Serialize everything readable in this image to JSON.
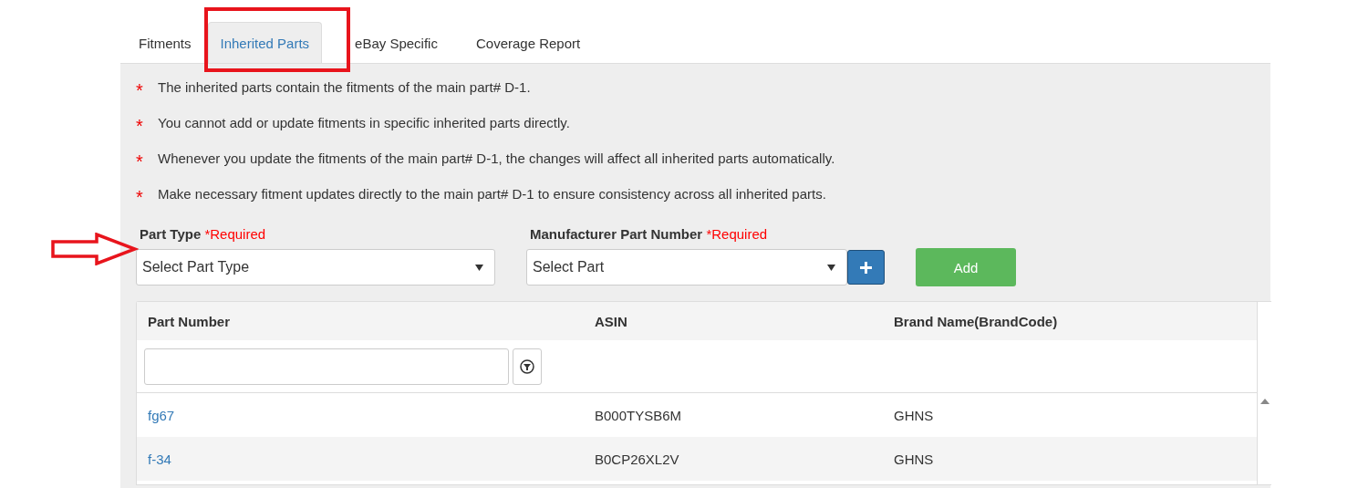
{
  "tabs": [
    {
      "label": "Fitments",
      "selected": false
    },
    {
      "label": "Inherited Parts",
      "selected": true
    },
    {
      "label": "eBay Specific",
      "selected": false
    },
    {
      "label": "Coverage Report",
      "selected": false
    }
  ],
  "notes": [
    {
      "marker": "*",
      "text": "The inherited parts contain the fitments of the main part# D-1."
    },
    {
      "marker": "*",
      "text": "You cannot add or update fitments in specific inherited parts directly."
    },
    {
      "marker": "*",
      "text": "Whenever you update the fitments of the main part# D-1, the changes will affect all inherited parts automatically."
    },
    {
      "marker": "*",
      "text": "Make necessary fitment updates directly to the main part# D-1 to ensure consistency across all inherited parts."
    }
  ],
  "fields": [
    {
      "label": "Part Type",
      "required": "*Required",
      "placeholder": "Select Part Type",
      "add_button": false
    },
    {
      "label": "Manufacturer Part Number",
      "required": "*Required",
      "placeholder": "Select Part",
      "add_button": true
    }
  ],
  "add_button": {
    "label": "Add"
  },
  "table": {
    "columns": [
      "Part Number",
      "ASIN",
      "Brand Name(BrandCode)"
    ],
    "rows": [
      {
        "part_number": "fg67",
        "asin": "B000TYSB6M",
        "brand": "GHNS"
      },
      {
        "part_number": "f-34",
        "asin": "B0CP26XL2V",
        "brand": "GHNS"
      }
    ]
  }
}
